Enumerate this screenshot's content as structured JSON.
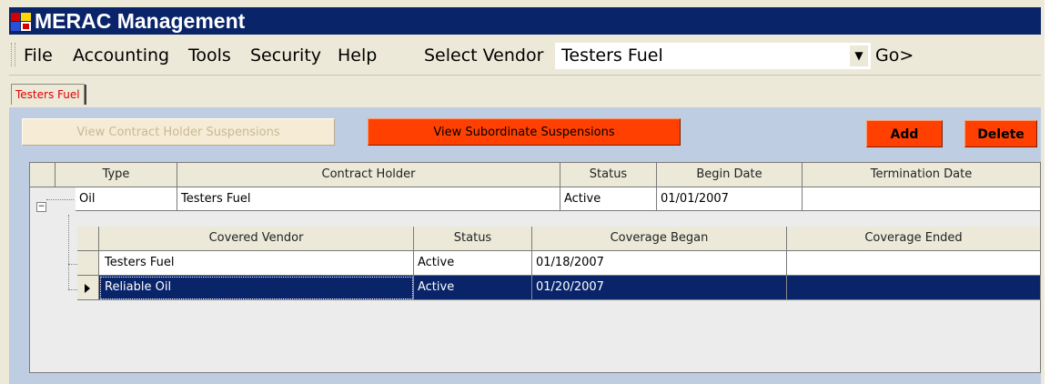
{
  "window": {
    "title": "MERAC Management"
  },
  "menu": {
    "items": [
      "File",
      "Accounting",
      "Tools",
      "Security",
      "Help"
    ],
    "vendor_label": "Select Vendor",
    "vendor_value": "Testers Fuel",
    "go_label": "Go>"
  },
  "tabs": [
    "Testers Fuel"
  ],
  "buttons": {
    "view_holder": "View Contract Holder Suspensions",
    "view_subordinate": "View Subordinate Suspensions",
    "add": "Add",
    "delete": "Delete"
  },
  "grid": {
    "columns": [
      "Type",
      "Contract Holder",
      "Status",
      "Begin Date",
      "Termination Date"
    ],
    "row": {
      "type": "Oil",
      "contract_holder": "Testers Fuel",
      "status": "Active",
      "begin_date": "01/01/2007",
      "termination_date": ""
    },
    "sub_columns": [
      "Covered Vendor",
      "Status",
      "Coverage Began",
      "Coverage Ended"
    ],
    "sub_rows": [
      {
        "vendor": "Testers Fuel",
        "status": "Active",
        "began": "01/18/2007",
        "ended": ""
      },
      {
        "vendor": "Reliable Oil",
        "status": "Active",
        "began": "01/20/2007",
        "ended": ""
      }
    ],
    "selected_sub_row": 1
  },
  "icons": {
    "app": "app-icon",
    "expander": "collapse-icon",
    "row-selector": "current-row-arrow-icon",
    "dropdown": "chevron-down-icon"
  },
  "colors": {
    "titlebar": "#0a246a",
    "accent_button": "#ff4000",
    "selection": "#0a246a",
    "tab_text": "#e00000"
  }
}
